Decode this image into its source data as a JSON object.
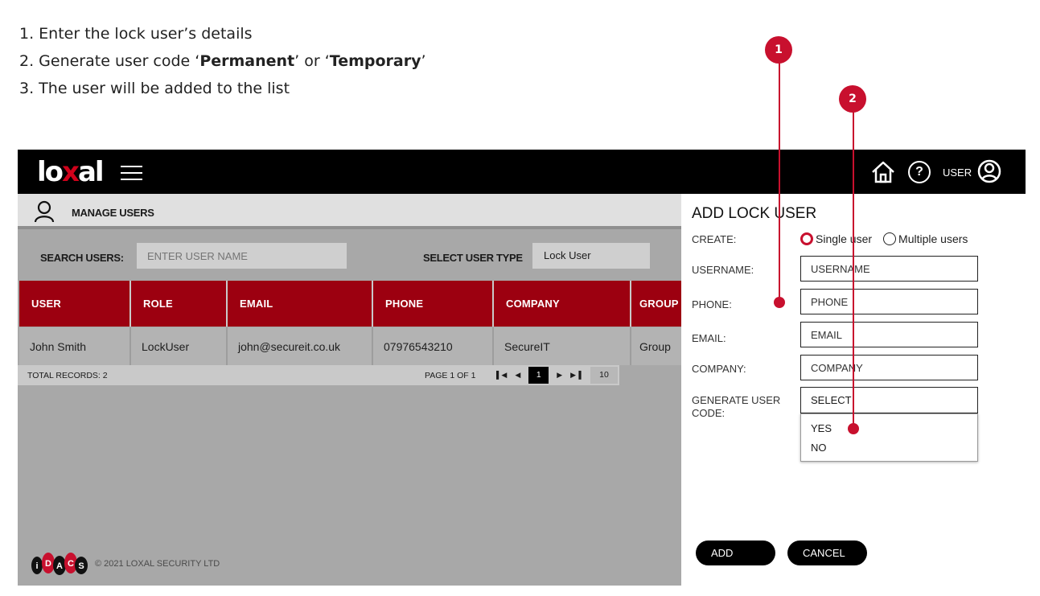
{
  "instructions": {
    "line1": "1. Enter the lock user’s details",
    "line2_pre": "2. Generate user code ‘",
    "line2_b1": "Permanent",
    "line2_mid": "’ or ‘",
    "line2_b2": "Temporary",
    "line2_post": "’",
    "line3": "3. The user will be added to the list"
  },
  "markers": {
    "m1": "1",
    "m2": "2"
  },
  "topbar": {
    "logo_pre": "lo",
    "logo_x": "x",
    "logo_post": "al",
    "help_glyph": "?",
    "user_label": "USER"
  },
  "manage": {
    "title": "MANAGE USERS",
    "search_label": "SEARCH USERS:",
    "search_placeholder": "ENTER USER NAME",
    "type_label": "SELECT USER TYPE",
    "type_value": "Lock User"
  },
  "table": {
    "headers": [
      "USER",
      "ROLE",
      "EMAIL",
      "PHONE",
      "COMPANY",
      "GROUP"
    ],
    "rows": [
      [
        "John Smith",
        "LockUser",
        "john@secureit.co.uk",
        "07976543210",
        "SecureIT",
        "Group"
      ]
    ]
  },
  "pagination": {
    "total": "TOTAL RECORDS: 2",
    "page_info": "PAGE 1 OF 1",
    "current_page": "1",
    "page_size": "10"
  },
  "footer": {
    "idacs_letters": [
      "i",
      "D",
      "A",
      "C",
      "S"
    ],
    "copyright": "© 2021 LOXAL SECURITY LTD"
  },
  "panel": {
    "title": "ADD LOCK USER",
    "create_label": "CREATE:",
    "single": "Single user",
    "multiple": "Multiple users",
    "username_label": "USERNAME:",
    "username_ph": "USERNAME",
    "phone_label": "PHONE:",
    "phone_ph": "PHONE",
    "email_label": "EMAIL:",
    "email_ph": "EMAIL",
    "company_label": "COMPANY:",
    "company_ph": "COMPANY",
    "code_label_1": "GENERATE USER",
    "code_label_2": "CODE:",
    "code_select": "SELECT",
    "options": [
      "YES",
      "NO"
    ],
    "add": "ADD",
    "cancel": "CANCEL"
  },
  "colors": {
    "accent": "#c8102e",
    "table_header": "#9c0010",
    "topbar": "#000000",
    "app_bg": "#a8a8a8"
  },
  "icons": [
    "menu-icon",
    "home-icon",
    "help-icon",
    "user-circle-icon",
    "person-icon",
    "first-page-icon",
    "prev-page-icon",
    "next-page-icon",
    "last-page-icon"
  ]
}
